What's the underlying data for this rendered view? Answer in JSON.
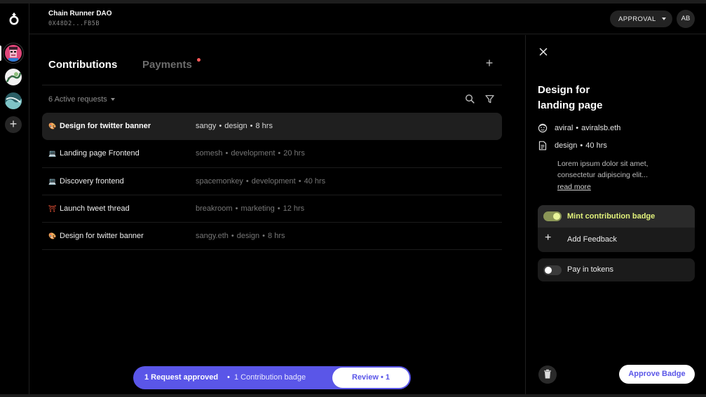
{
  "header": {
    "dao_name": "Chain Runner DAO",
    "dao_address": "0X48D2...FB5B",
    "approval_label": "APPROVAL",
    "user_initials": "AB"
  },
  "sidebar": {
    "add_label": "+"
  },
  "main": {
    "tabs": [
      {
        "label": "Contributions",
        "active": true
      },
      {
        "label": "Payments",
        "active": false,
        "has_notification": true
      }
    ],
    "add_label": "+",
    "active_requests_label": "6 Active requests",
    "rows": [
      {
        "icon": "🎨",
        "title": "Design for twitter banner",
        "user": "sangy",
        "category": "design",
        "hours": "8 hrs",
        "selected": true
      },
      {
        "icon": "💻",
        "title": "Landing page Frontend",
        "user": "somesh",
        "category": "development",
        "hours": "20 hrs",
        "selected": false
      },
      {
        "icon": "💻",
        "title": "Discovery frontend",
        "user": "spacemonkey",
        "category": "development",
        "hours": "40 hrs",
        "selected": false
      },
      {
        "icon": "⛩",
        "title": "Launch tweet thread",
        "user": "breakroom",
        "category": "marketing",
        "hours": "12 hrs",
        "selected": false
      },
      {
        "icon": "🎨",
        "title": "Design for twitter banner",
        "user": "sangy.eth",
        "category": "design",
        "hours": "8 hrs",
        "selected": false
      }
    ],
    "dot": "•",
    "action_bar": {
      "approved_label": "1 Request approved",
      "separator": "•",
      "badge_label": "1 Contribution badge",
      "review_label": "Review • 1"
    }
  },
  "panel": {
    "title_line1": "Design for",
    "title_line2": "landing page",
    "user": "aviral",
    "ens": "aviralsb.eth",
    "category": "design",
    "hours": "40 hrs",
    "description": "Lorem ipsum dolor sit amet, consectetur adipiscing elit...",
    "read_more": "read more",
    "mint_label": "Mint contribution badge",
    "mint_enabled": true,
    "feedback_label": "Add Feedback",
    "pay_tokens_label": "Pay in tokens",
    "pay_tokens_enabled": false,
    "approve_label": "Approve Badge"
  },
  "colors": {
    "accent": "#5a56e8",
    "mint_text": "#e2f27b",
    "notification": "#ff5a5a"
  }
}
